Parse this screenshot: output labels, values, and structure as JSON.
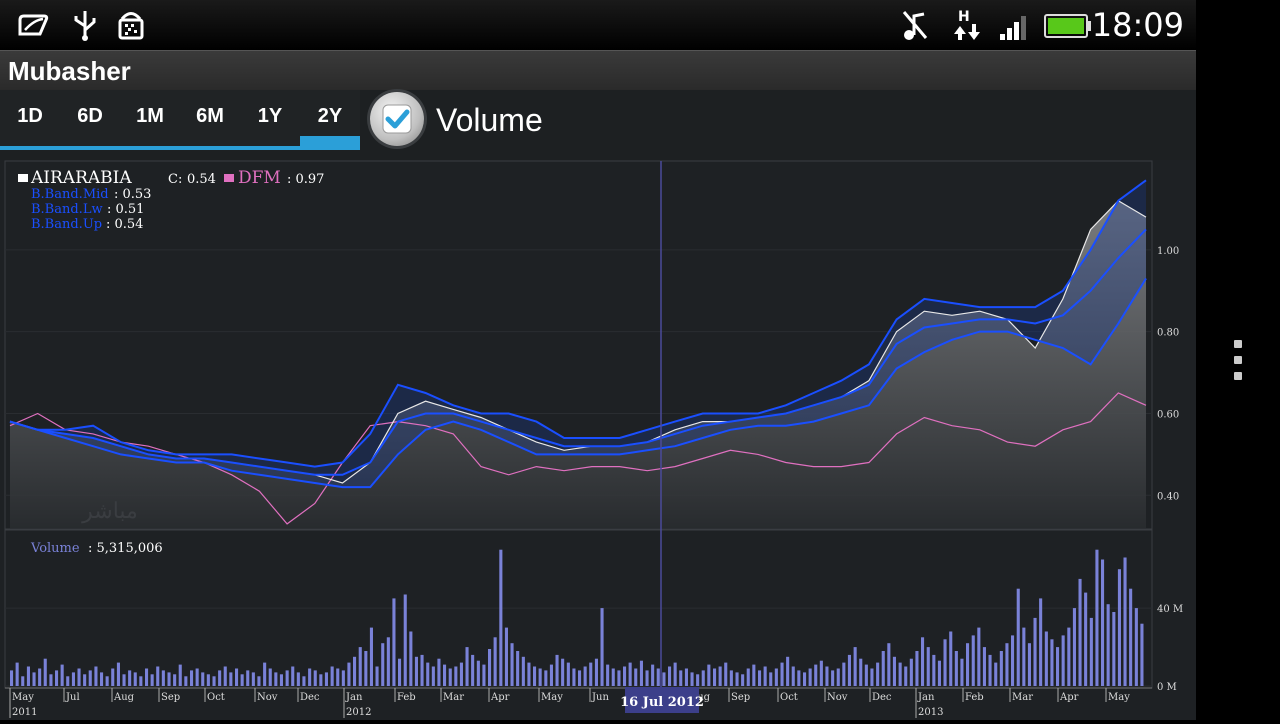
{
  "status_bar": {
    "time": "18:09",
    "icons": [
      "leaf-notification-icon",
      "usb-icon",
      "android-debug-icon",
      "mute-icon",
      "hspa-data-icon",
      "signal-icon",
      "battery-icon"
    ]
  },
  "app": {
    "title": "Mubasher"
  },
  "range_tabs": [
    {
      "label": "1D",
      "selected": false
    },
    {
      "label": "6D",
      "selected": false
    },
    {
      "label": "1M",
      "selected": false
    },
    {
      "label": "6M",
      "selected": false
    },
    {
      "label": "1Y",
      "selected": false
    },
    {
      "label": "2Y",
      "selected": true
    }
  ],
  "volume_toggle": {
    "label": "Volume",
    "checked": true
  },
  "colors": {
    "accent": "#2b9fd8",
    "bband": "#1a4fff",
    "dfm": "#e070c0",
    "volume": "#7a82d8",
    "background": "#1e2124"
  },
  "legend": {
    "symbol": "AIRARABIA",
    "close_label": "C:",
    "close_value": "0.54",
    "dfm_label": "DFM",
    "dfm_value": ": 0.97",
    "bb_mid_label": "B.Band.Mid",
    "bb_mid_value": ": 0.53",
    "bb_lw_label": "B.Band.Lw",
    "bb_lw_value": ": 0.51",
    "bb_up_label": "B.Band.Up",
    "bb_up_value": ": 0.54",
    "volume_label": "Volume",
    "volume_value": ": 5,315,006"
  },
  "crosshair_label": "16 Jul 2012",
  "chart_data": [
    {
      "type": "area",
      "y_ticks": [
        "1.00",
        "0.80",
        "0.60",
        "0.40"
      ],
      "ylim": [
        0.32,
        1.2
      ],
      "x_ticks": [
        "May",
        "Jul",
        "Aug",
        "Sep",
        "Oct",
        "Nov",
        "Dec",
        "Jan",
        "Feb",
        "Mar",
        "Apr",
        "May",
        "Jun",
        "Aug",
        "Sep",
        "Oct",
        "Nov",
        "Dec",
        "Jan",
        "Feb",
        "Mar",
        "Apr",
        "May"
      ],
      "year_ticks": [
        "2011",
        "2012",
        "2013"
      ],
      "grid": true,
      "series": [
        {
          "name": "AIRARABIA",
          "values": [
            0.58,
            0.56,
            0.55,
            0.54,
            0.52,
            0.5,
            0.49,
            0.49,
            0.48,
            0.47,
            0.46,
            0.45,
            0.43,
            0.48,
            0.6,
            0.63,
            0.61,
            0.59,
            0.56,
            0.53,
            0.51,
            0.52,
            0.52,
            0.53,
            0.56,
            0.58,
            0.58,
            0.59,
            0.6,
            0.62,
            0.64,
            0.68,
            0.8,
            0.85,
            0.84,
            0.85,
            0.83,
            0.76,
            0.88,
            1.05,
            1.12,
            1.08
          ]
        },
        {
          "name": "DFM",
          "values": [
            0.57,
            0.6,
            0.56,
            0.55,
            0.53,
            0.52,
            0.5,
            0.48,
            0.45,
            0.41,
            0.33,
            0.38,
            0.48,
            0.57,
            0.58,
            0.57,
            0.55,
            0.47,
            0.45,
            0.47,
            0.46,
            0.47,
            0.47,
            0.46,
            0.47,
            0.49,
            0.51,
            0.5,
            0.48,
            0.47,
            0.47,
            0.48,
            0.55,
            0.59,
            0.57,
            0.56,
            0.53,
            0.52,
            0.56,
            0.58,
            0.65,
            0.62
          ]
        },
        {
          "name": "B.Band.Up",
          "values": [
            0.58,
            0.56,
            0.56,
            0.57,
            0.53,
            0.51,
            0.5,
            0.5,
            0.5,
            0.49,
            0.48,
            0.47,
            0.48,
            0.55,
            0.67,
            0.65,
            0.62,
            0.6,
            0.6,
            0.58,
            0.54,
            0.54,
            0.54,
            0.56,
            0.58,
            0.6,
            0.6,
            0.6,
            0.62,
            0.65,
            0.68,
            0.72,
            0.83,
            0.88,
            0.87,
            0.86,
            0.86,
            0.86,
            0.9,
            1.0,
            1.12,
            1.17
          ]
        },
        {
          "name": "B.Band.Mid",
          "values": [
            0.58,
            0.56,
            0.55,
            0.54,
            0.52,
            0.5,
            0.49,
            0.49,
            0.48,
            0.47,
            0.46,
            0.45,
            0.45,
            0.48,
            0.58,
            0.6,
            0.6,
            0.58,
            0.56,
            0.54,
            0.52,
            0.52,
            0.52,
            0.53,
            0.55,
            0.57,
            0.58,
            0.59,
            0.6,
            0.62,
            0.64,
            0.67,
            0.77,
            0.81,
            0.82,
            0.83,
            0.83,
            0.82,
            0.84,
            0.9,
            0.98,
            1.05
          ]
        },
        {
          "name": "B.Band.Lw",
          "values": [
            0.58,
            0.56,
            0.54,
            0.52,
            0.5,
            0.49,
            0.48,
            0.48,
            0.46,
            0.45,
            0.44,
            0.43,
            0.42,
            0.42,
            0.5,
            0.56,
            0.58,
            0.56,
            0.53,
            0.5,
            0.5,
            0.5,
            0.5,
            0.51,
            0.52,
            0.54,
            0.56,
            0.57,
            0.57,
            0.58,
            0.6,
            0.62,
            0.71,
            0.75,
            0.78,
            0.8,
            0.8,
            0.78,
            0.76,
            0.72,
            0.82,
            0.93
          ]
        }
      ]
    },
    {
      "type": "bar",
      "y_ticks": [
        "40 M",
        "0 M"
      ],
      "ylim": [
        0,
        75
      ],
      "series": [
        {
          "name": "Volume",
          "values": [
            8,
            12,
            5,
            10,
            7,
            9,
            14,
            6,
            8,
            11,
            5,
            7,
            9,
            6,
            8,
            10,
            7,
            5,
            9,
            12,
            6,
            8,
            7,
            5,
            9,
            6,
            10,
            8,
            7,
            6,
            11,
            5,
            8,
            9,
            7,
            6,
            5,
            8,
            10,
            7,
            9,
            6,
            8,
            7,
            5,
            12,
            9,
            7,
            6,
            8,
            10,
            7,
            5,
            9,
            8,
            6,
            7,
            10,
            9,
            8,
            12,
            15,
            20,
            18,
            30,
            10,
            22,
            25,
            45,
            14,
            47,
            28,
            15,
            16,
            12,
            10,
            14,
            11,
            9,
            10,
            12,
            20,
            16,
            13,
            11,
            19,
            25,
            70,
            30,
            22,
            18,
            15,
            12,
            10,
            9,
            8,
            11,
            16,
            14,
            12,
            9,
            8,
            10,
            12,
            14,
            40,
            11,
            9,
            8,
            10,
            12,
            9,
            13,
            8,
            11,
            9,
            7,
            10,
            12,
            8,
            9,
            7,
            6,
            8,
            11,
            9,
            10,
            12,
            8,
            7,
            6,
            9,
            11,
            8,
            10,
            7,
            9,
            12,
            15,
            10,
            8,
            7,
            9,
            11,
            13,
            10,
            8,
            9,
            12,
            16,
            20,
            14,
            11,
            9,
            12,
            18,
            22,
            15,
            12,
            10,
            14,
            18,
            25,
            20,
            16,
            13,
            24,
            28,
            18,
            14,
            22,
            26,
            30,
            20,
            16,
            12,
            18,
            22,
            26,
            50,
            30,
            22,
            35,
            45,
            28,
            24,
            20,
            26,
            30,
            40,
            55,
            48,
            35,
            70,
            65,
            42,
            38,
            60,
            66,
            50,
            40,
            32
          ]
        }
      ]
    }
  ]
}
